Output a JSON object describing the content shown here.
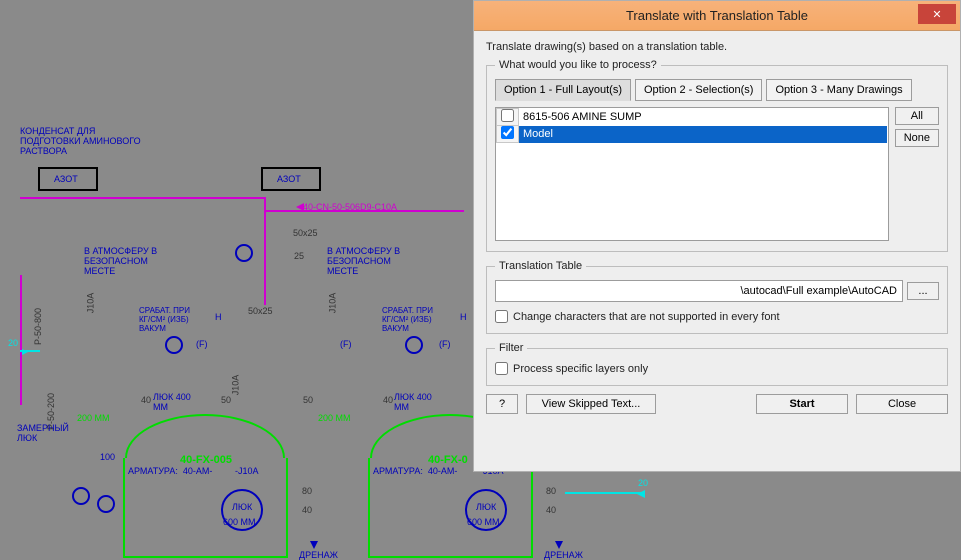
{
  "dialog": {
    "title": "Translate with Translation Table",
    "note": "Translate drawing(s) based on a translation table.",
    "process_legend": "What would you like to process?",
    "tabs": {
      "opt1": "Option 1 - Full Layout(s)",
      "opt2": "Option 2 - Selection(s)",
      "opt3": "Option 3 - Many Drawings"
    },
    "list_items": [
      {
        "checked": false,
        "label": "8615-506 AMINE SUMP"
      },
      {
        "checked": true,
        "label": "Model"
      }
    ],
    "all": "All",
    "none": "None",
    "trans_legend": "Translation Table",
    "path_value": "\\autocad\\Full example\\AutoCAD",
    "browse": "...",
    "chk_chars": "Change characters that are not supported in every font",
    "filter_legend": "Filter",
    "chk_layers": "Process specific layers only",
    "help": "?",
    "view_skipped": "View Skipped Text...",
    "start": "Start",
    "close": "Close"
  },
  "cad": {
    "box_azot": "АЗОТ",
    "kondensat": "КОНДЕНСАТ ДЛЯ\nПОДГОТОВКИ АМИНОВОГО\nРАСТВОРА",
    "atmos1": "В АТМОСФЕРУ В\nБЕЗОПАСНОМ\nМЕСТЕ",
    "atmos2": "В АТМОСФЕРУ В\nБЕЗОПАСНОМ\nМЕСТЕ",
    "pipe1": "40-CN-50-506D9-C10A",
    "dim50x25a": "50x25",
    "dim50x25b": "50x25",
    "n25": "25",
    "n50": "50",
    "srabat": "СРАБАТ. ПРИ\nКГ/СМ² (ИЗБ)\nВАКУМ",
    "f": "(F)",
    "j10a": "J10A",
    "h": "Н",
    "n20": "20",
    "r50_800": "Р-50-800",
    "r50_200": "Р-50-200",
    "lyuk400": "ЛЮК 400\nММ",
    "mm200": "200 ММ",
    "zamerny": "ЗАМЕРНЫЙ\nЛЮК",
    "n100": "100",
    "n40": "40",
    "n80": "80",
    "armatura": "АРМАТУРА:  40-АМ-",
    "tail_j10a": "-J10A",
    "fxline1": "40-FX-005",
    "fxline2": "40-FX-0",
    "lyuk": "ЛЮК",
    "mm600": "600 ММ",
    "drenazh": "ДРЕНАЖ"
  }
}
